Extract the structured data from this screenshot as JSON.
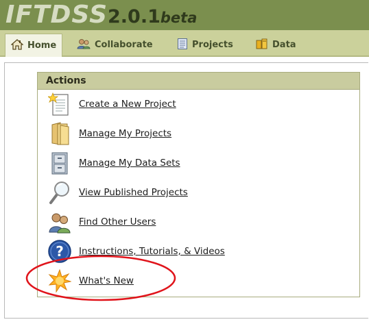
{
  "app": {
    "logo_main": "IFTDSS",
    "logo_version": "2.0.1",
    "logo_suffix": "beta"
  },
  "nav": {
    "tabs": [
      {
        "label": "Home",
        "icon": "house-icon",
        "active": true
      },
      {
        "label": "Collaborate",
        "icon": "users-icon",
        "active": false
      },
      {
        "label": "Projects",
        "icon": "document-icon",
        "active": false
      },
      {
        "label": "Data",
        "icon": "database-icon",
        "active": false
      }
    ]
  },
  "actions": {
    "title": "Actions",
    "items": [
      {
        "label": "Create a New Project",
        "icon": "new-document-icon"
      },
      {
        "label": "Manage My Projects",
        "icon": "folder-icon"
      },
      {
        "label": "Manage My Data Sets",
        "icon": "cabinet-icon"
      },
      {
        "label": "View Published Projects",
        "icon": "magnifier-icon"
      },
      {
        "label": "Find Other Users",
        "icon": "users-icon"
      },
      {
        "label": "Instructions, Tutorials, & Videos",
        "icon": "help-icon"
      },
      {
        "label": "What's New",
        "icon": "starburst-icon"
      }
    ]
  },
  "colors": {
    "header_bg": "#7b8f4e",
    "nav_bg": "#cbd19b",
    "panel_header_bg": "#c9cc9f",
    "highlight_ellipse": "#e0141b"
  }
}
